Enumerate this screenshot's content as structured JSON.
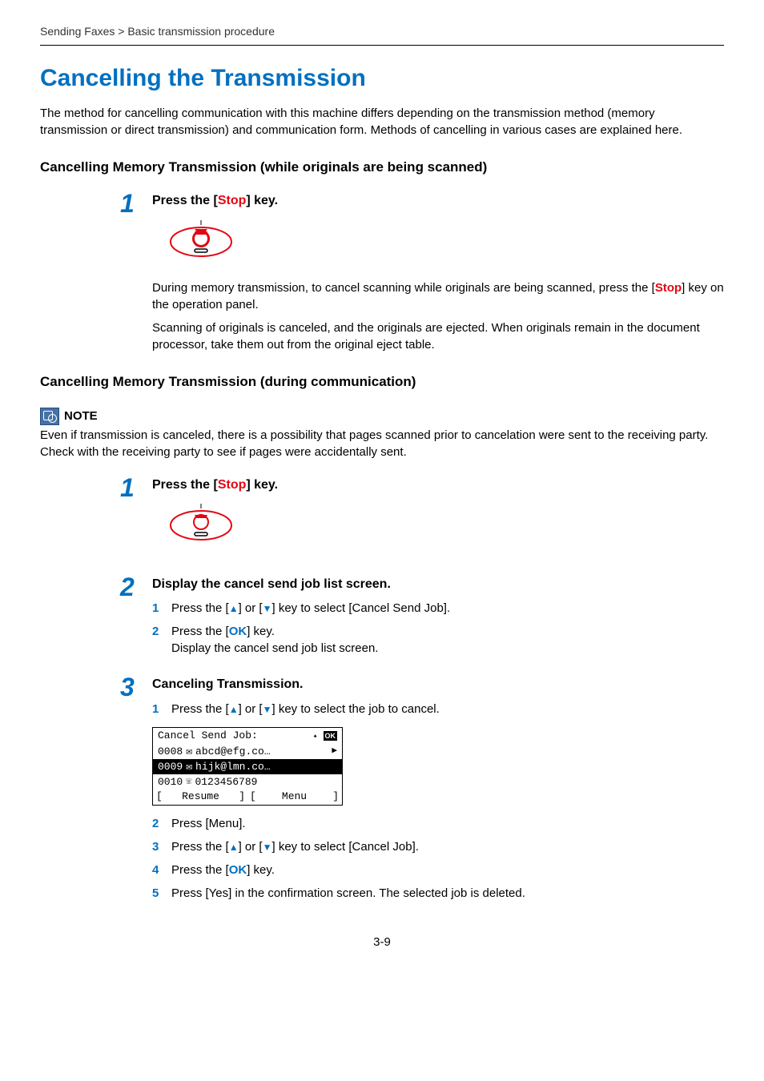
{
  "breadcrumb": "Sending Faxes > Basic transmission procedure",
  "title": "Cancelling the Transmission",
  "intro": "The method for cancelling communication with this machine differs depending on the transmission method (memory transmission or direct transmission) and communication form. Methods of cancelling in various cases are explained here.",
  "sectionA": {
    "heading": "Cancelling Memory Transmission (while originals are being scanned)",
    "step1": {
      "num": "1",
      "title_pre": "Press the [",
      "title_key": "Stop",
      "title_post": "] key.",
      "para1_pre": "During memory transmission, to cancel scanning while originals are being scanned, press the [",
      "para1_key": "Stop",
      "para1_post": "] key on the operation panel.",
      "para2": "Scanning of originals is canceled, and the originals are ejected. When originals remain in the document processor, take them out from the original eject table."
    }
  },
  "sectionB": {
    "heading": "Cancelling Memory Transmission (during communication)",
    "note_label": "NOTE",
    "note_body": "Even if transmission is canceled, there is a possibility that pages scanned prior to cancelation were sent to the receiving party. Check with the receiving party to see if pages were accidentally sent.",
    "step1": {
      "num": "1",
      "title_pre": "Press the [",
      "title_key": "Stop",
      "title_post": "] key."
    },
    "step2": {
      "num": "2",
      "title": "Display the cancel send job list screen.",
      "sub1_num": "1",
      "sub1_text": "Press the [▲] or [▼] key to select [Cancel Send Job].",
      "sub2_num": "2",
      "sub2_text_pre": "Press the [",
      "sub2_key": "OK",
      "sub2_text_post": "] key.",
      "sub2_text2": "Display the cancel send job list screen."
    },
    "step3": {
      "num": "3",
      "title": "Canceling Transmission.",
      "sub1_num": "1",
      "sub1_text": "Press the [▲] or [▼] key to select the job to cancel.",
      "lcd": {
        "header": "Cancel Send Job:",
        "ok": "OK",
        "r1_id": "0008",
        "r1_dest": "abcd@efg.co…",
        "r2_id": "0009",
        "r2_dest": "hijk@lmn.co…",
        "r3_id": "0010",
        "r3_dest": "0123456789",
        "sk1": "Resume",
        "sk2": "Menu"
      },
      "sub2_num": "2",
      "sub2_text": "Press [Menu].",
      "sub3_num": "3",
      "sub3_text": "Press the [▲] or [▼] key to select [Cancel Job].",
      "sub4_num": "4",
      "sub4_text_pre": "Press the [",
      "sub4_key": "OK",
      "sub4_text_post": "] key.",
      "sub5_num": "5",
      "sub5_text": "Press [Yes] in the confirmation screen. The selected job is deleted."
    }
  },
  "page_number": "3-9"
}
